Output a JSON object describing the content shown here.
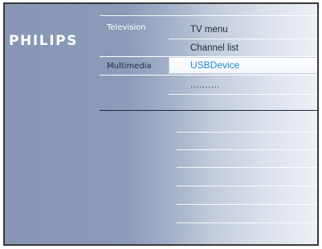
{
  "brand": {
    "name": "PHILIPS"
  },
  "categories": [
    {
      "label": "Television",
      "active": false
    },
    {
      "label": "Multimedia",
      "active": true
    }
  ],
  "menu": {
    "items": [
      {
        "label": "TV menu",
        "suffix": ". . ."
      },
      {
        "label": "Channel list"
      },
      {
        "label": "USBDevice",
        "selected": true
      },
      {
        "label": "..........",
        "placeholder": true
      }
    ]
  },
  "colors": {
    "highlight_text": "#1e88c8",
    "background_left": "#8696b4",
    "background_right": "#eef1f6"
  }
}
